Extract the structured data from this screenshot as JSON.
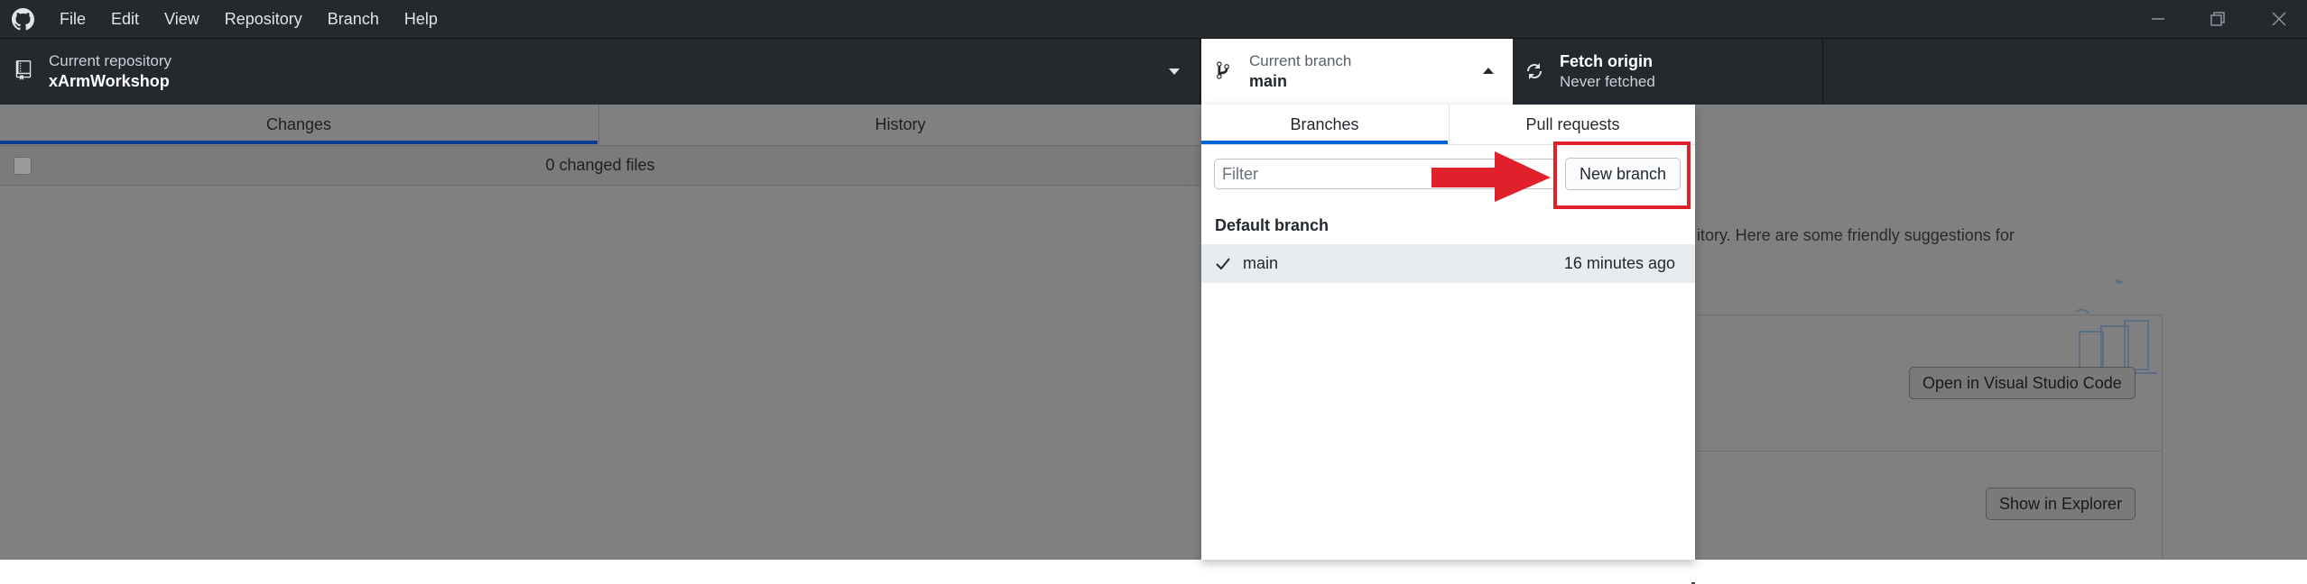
{
  "titlebar": {
    "menu": [
      "File",
      "Edit",
      "View",
      "Repository",
      "Branch",
      "Help"
    ]
  },
  "toolbar": {
    "repo": {
      "label": "Current repository",
      "value": "xArmWorkshop"
    },
    "branch": {
      "label": "Current branch",
      "value": "main"
    },
    "fetch": {
      "label": "Fetch origin",
      "value": "Never fetched"
    }
  },
  "main": {
    "tabs": [
      {
        "label": "Changes"
      },
      {
        "label": "History"
      }
    ],
    "changed_files": "0 changed files",
    "suggestion_text": "itory. Here are some friendly suggestions for",
    "buttons": {
      "open_vscode": "Open in Visual Studio Code",
      "show_explorer": "Show in Explorer"
    }
  },
  "dropdown": {
    "tabs": [
      {
        "label": "Branches"
      },
      {
        "label": "Pull requests"
      }
    ],
    "filter_placeholder": "Filter",
    "new_branch_label": "New branch",
    "default_branch_label": "Default branch",
    "branches": [
      {
        "name": "main",
        "time": "16 minutes ago"
      }
    ]
  },
  "colors": {
    "titlebar_bg": "#24292e",
    "accent": "#0366d6",
    "annotation": "#e0202a"
  }
}
